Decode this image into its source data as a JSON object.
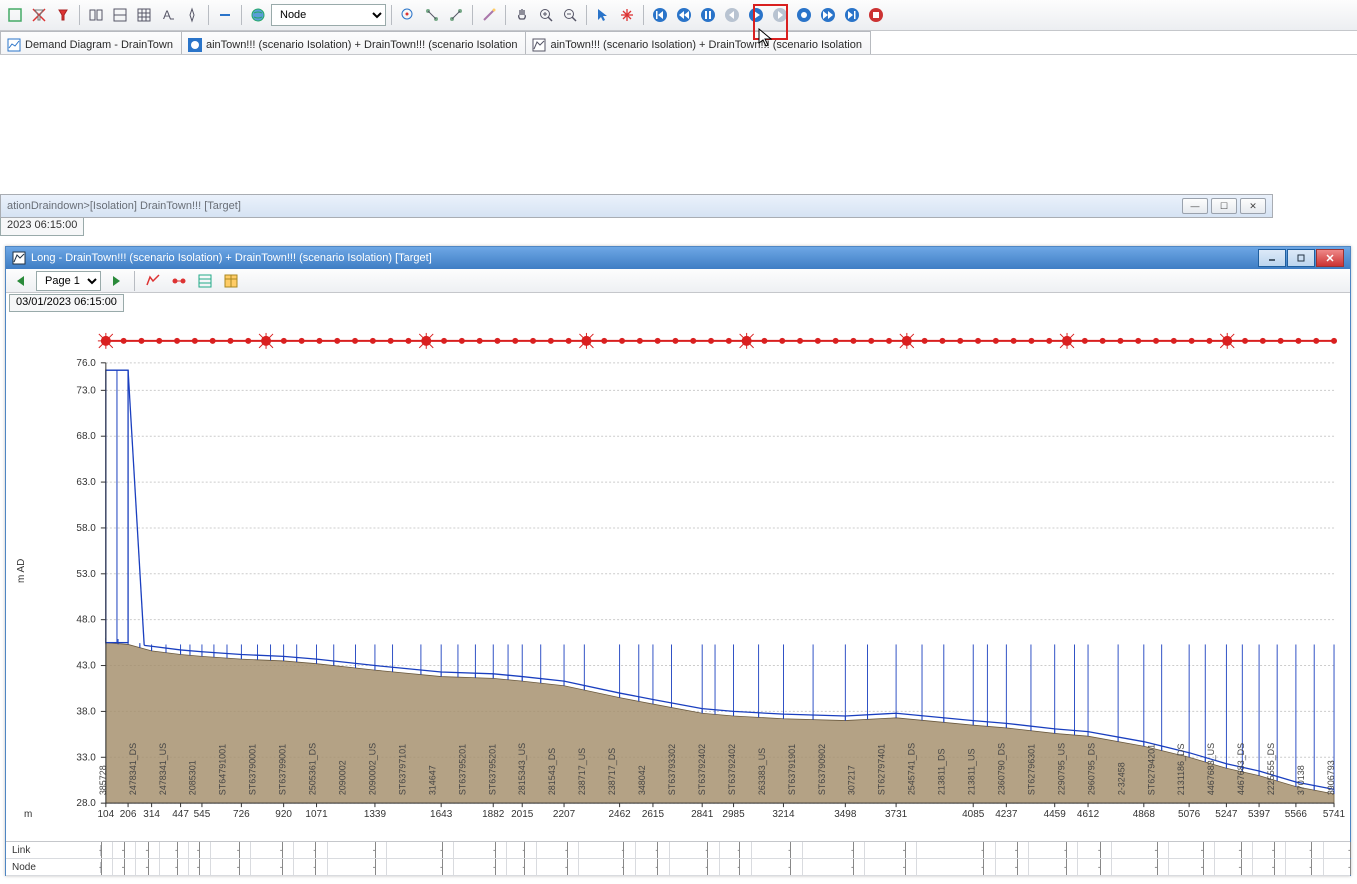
{
  "toolbar": {
    "combo_value": "Node"
  },
  "tabs": [
    {
      "label": "Demand Diagram - DrainTown"
    },
    {
      "label": "ainTown!!! (scenario Isolation)  + DrainTown!!! (scenario Isolation"
    },
    {
      "label": "ainTown!!! (scenario Isolation)  + DrainTown!!! (scenario Isolation"
    }
  ],
  "subwindow": {
    "title": "ationDraindown>[Isolation] DrainTown!!!  [Target]",
    "timestamp": "2023 06:15:00"
  },
  "longwin": {
    "title": "Long - DrainTown!!! (scenario Isolation)  + DrainTown!!! (scenario Isolation) [Target]",
    "page": "Page 1",
    "timestamp": "03/01/2023 06:15:00"
  },
  "bottom_labels": {
    "link": "Link",
    "node": "Node"
  },
  "chart_data": {
    "type": "profile",
    "y_axis_label": "m AD",
    "x_axis_label": "m",
    "ylim": [
      28,
      76
    ],
    "y_ticks": [
      28.0,
      33.0,
      38.0,
      43.0,
      48.0,
      53.0,
      58.0,
      63.0,
      68.0,
      73.0,
      76.0
    ],
    "x_ticks": [
      104,
      206,
      314,
      447,
      545,
      726,
      920,
      1071,
      1339,
      1643,
      1882,
      2015,
      2207,
      2462,
      2615,
      2841,
      2985,
      3214,
      3498,
      3731,
      4085,
      4237,
      4459,
      4612,
      4868,
      5076,
      5247,
      5397,
      5566,
      5741
    ],
    "hgl_line": 75.2,
    "ground_profile": [
      {
        "x": 104,
        "y": 45.5
      },
      {
        "x": 206,
        "y": 45.3
      },
      {
        "x": 314,
        "y": 44.6
      },
      {
        "x": 447,
        "y": 44.2
      },
      {
        "x": 545,
        "y": 44.0
      },
      {
        "x": 726,
        "y": 43.7
      },
      {
        "x": 920,
        "y": 43.5
      },
      {
        "x": 1071,
        "y": 43.2
      },
      {
        "x": 1339,
        "y": 42.5
      },
      {
        "x": 1643,
        "y": 41.8
      },
      {
        "x": 1882,
        "y": 41.6
      },
      {
        "x": 2015,
        "y": 41.3
      },
      {
        "x": 2207,
        "y": 40.8
      },
      {
        "x": 2462,
        "y": 39.5
      },
      {
        "x": 2615,
        "y": 38.8
      },
      {
        "x": 2841,
        "y": 37.8
      },
      {
        "x": 2985,
        "y": 37.5
      },
      {
        "x": 3214,
        "y": 37.2
      },
      {
        "x": 3498,
        "y": 37.0
      },
      {
        "x": 3731,
        "y": 37.3
      },
      {
        "x": 4085,
        "y": 36.5
      },
      {
        "x": 4237,
        "y": 36.2
      },
      {
        "x": 4459,
        "y": 35.6
      },
      {
        "x": 4612,
        "y": 35.3
      },
      {
        "x": 4868,
        "y": 34.2
      },
      {
        "x": 5076,
        "y": 33.0
      },
      {
        "x": 5247,
        "y": 31.8
      },
      {
        "x": 5397,
        "y": 31.0
      },
      {
        "x": 5566,
        "y": 29.8
      },
      {
        "x": 5741,
        "y": 29.0
      }
    ],
    "tank_section": {
      "x_start": 104,
      "x_end": 206,
      "level": 75.2
    },
    "node_labels": [
      "385728",
      "2478341_DS",
      "2478341_US",
      "2085301",
      "ST64791001",
      "ST63790001",
      "ST63799001",
      "2505361_DS",
      "2090002",
      "2090002_US",
      "ST63797101",
      "314647",
      "ST63795201",
      "ST63795201",
      "2815343_US",
      "281543_DS",
      "238717_US",
      "238717_DS",
      "348042",
      "ST63793302",
      "ST63792402",
      "ST63792402",
      "263383_US",
      "ST63791901",
      "ST63790902",
      "307217",
      "ST62797401",
      "2545741_DS",
      "213811_DS",
      "213811_US",
      "2360790_DS",
      "ST62796301",
      "2290795_US",
      "2960795_DS",
      "2-32458",
      "ST62794201",
      "2131186_DS",
      "4467683_US",
      "4467683_DS",
      "2225555_DS",
      "370138",
      "3906793"
    ]
  }
}
